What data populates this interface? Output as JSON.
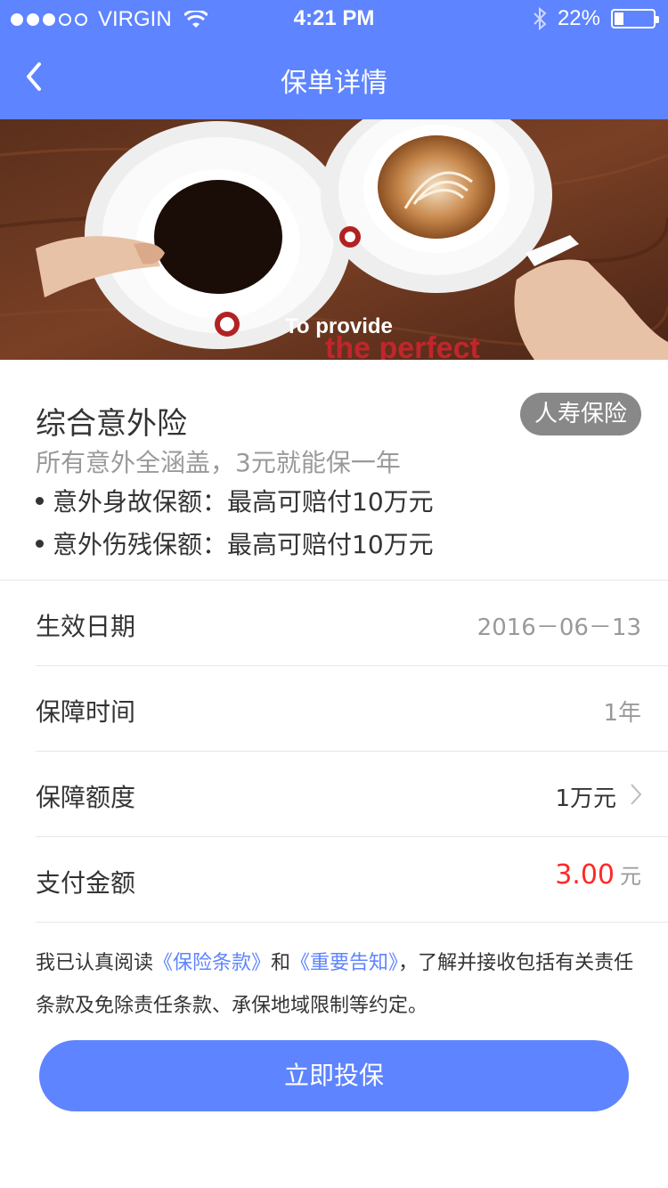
{
  "status_bar": {
    "carrier": "VIRGIN",
    "time": "4:21 PM",
    "battery": "22%",
    "battery_level": 0.22,
    "signal_strength": 3
  },
  "nav": {
    "title": "保单详情",
    "back_icon": "chevron-left-icon"
  },
  "banner": {
    "text_line1": "To provide",
    "text_line2": "the perfect"
  },
  "product": {
    "name": "综合意外险",
    "tag": "人寿保险",
    "subtitle": "所有意外全涵盖，3元就能保一年",
    "bullets": [
      "意外身故保额：最高可赔付10万元",
      "意外伤残保额：最高可赔付10万元"
    ]
  },
  "details": {
    "effective_label": "生效日期",
    "effective_value": "2016－06－13",
    "period_label": "保障时间",
    "period_value": "1年",
    "coverage_label": "保障额度",
    "coverage_value": "1万元",
    "payment_label": "支付金额",
    "payment_amount": "3.00",
    "payment_unit": "元"
  },
  "notice": {
    "prefix": "我已认真阅读",
    "link1": "《保险条款》",
    "mid": "和",
    "link2": "《重要告知》",
    "suffix": "，了解并接收包括有关责任条款及免除责任条款、承保地域限制等约定。"
  },
  "cta": {
    "label": "立即投保"
  },
  "colors": {
    "accent": "#5e84ff",
    "price": "#ff2828",
    "tag_bg": "#888888"
  }
}
